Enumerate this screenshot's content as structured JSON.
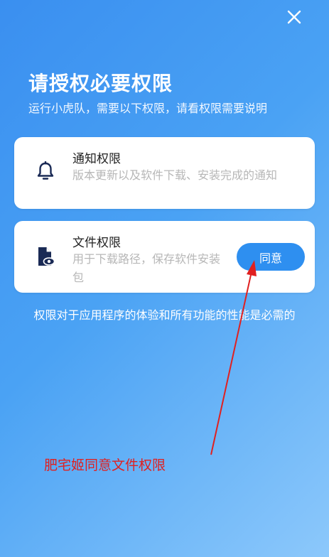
{
  "header": {
    "close_icon": "close-icon",
    "title": "请授权必要权限",
    "subtitle": "运行小虎队，需要以下权限，请看权限需要说明"
  },
  "permissions": [
    {
      "icon": "bell-icon",
      "title": "通知权限",
      "description": "版本更新以及软件下载、安装完成的通知"
    },
    {
      "icon": "file-eye-icon",
      "title": "文件权限",
      "description": "用于下载路径，保存软件安装包",
      "button_label": "同意"
    }
  ],
  "footer_note": "权限对于应用程序的体验和所有功能的性能是必需的",
  "annotation": {
    "text": "肥宅姬同意文件权限",
    "color": "#e02020"
  },
  "colors": {
    "background_start": "#3a8ff0",
    "background_end": "#8cc8fb",
    "button": "#2e8ff0",
    "icon": "#1a2a55"
  }
}
